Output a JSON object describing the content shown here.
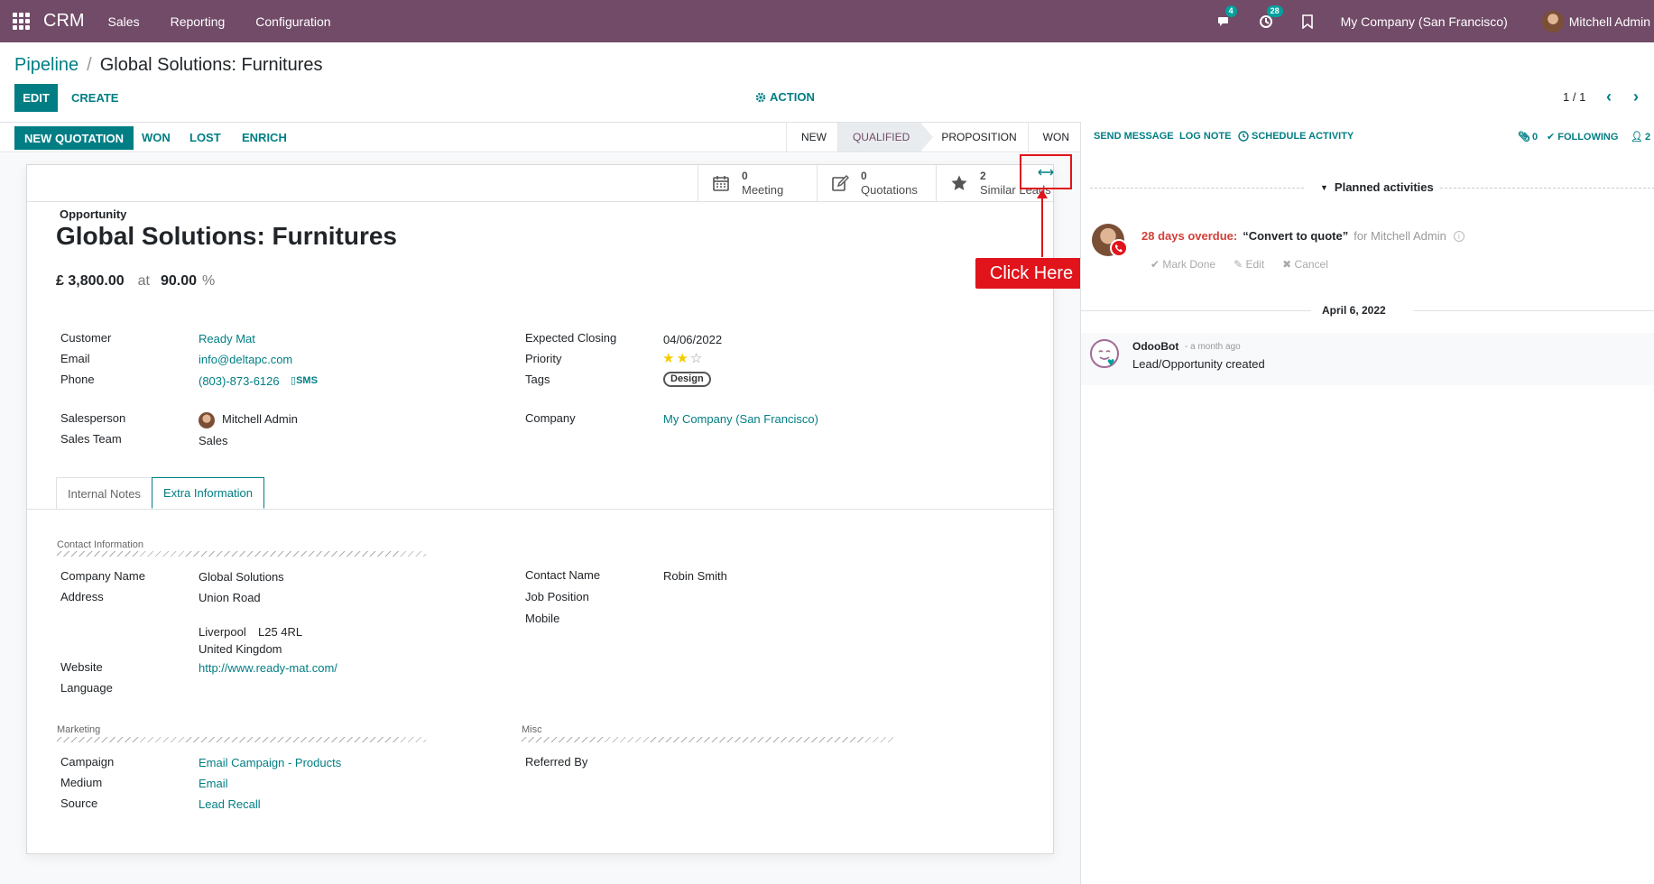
{
  "navbar": {
    "app_name": "CRM",
    "menu": [
      "Sales",
      "Reporting",
      "Configuration"
    ],
    "messages_count": "4",
    "activities_count": "28",
    "company": "My Company (San Francisco)",
    "user": "Mitchell Admin",
    "color": "#714b67"
  },
  "breadcrumb": {
    "parent": "Pipeline",
    "separator": "/",
    "current": "Global Solutions: Furnitures"
  },
  "controls": {
    "edit": "EDIT",
    "create": "CREATE",
    "action": "ACTION",
    "pager": "1 / 1"
  },
  "statusbar": {
    "new_quotation": "NEW QUOTATION",
    "won": "WON",
    "lost": "LOST",
    "enrich": "ENRICH",
    "stages": [
      "NEW",
      "QUALIFIED",
      "PROPOSITION",
      "WON"
    ],
    "active_stage": "QUALIFIED"
  },
  "smart_buttons": [
    {
      "count": "0",
      "label": "Meeting",
      "icon": "calendar-icon"
    },
    {
      "count": "0",
      "label": "Quotations",
      "icon": "edit-icon"
    },
    {
      "count": "2",
      "label": "Similar Leads",
      "icon": "star-icon"
    }
  ],
  "annotation": {
    "callout": "Click Here",
    "color": "#e1141b"
  },
  "form": {
    "type_label": "Opportunity",
    "title": "Global Solutions: Furnitures",
    "revenue": "£ 3,800.00",
    "at": "at",
    "probability": "90.00",
    "percent": "%",
    "fields_left": {
      "customer_label": "Customer",
      "customer": "Ready Mat",
      "email_label": "Email",
      "email": "info@deltapc.com",
      "phone_label": "Phone",
      "phone": "(803)-873-6126",
      "sms": "SMS",
      "salesperson_label": "Salesperson",
      "salesperson": "Mitchell Admin",
      "team_label": "Sales Team",
      "team": "Sales"
    },
    "fields_right": {
      "closing_label": "Expected Closing",
      "closing": "04/06/2022",
      "priority_label": "Priority",
      "priority_stars": 2,
      "priority_max": 3,
      "tags_label": "Tags",
      "tag": "Design",
      "company_label": "Company",
      "company": "My Company (San Francisco)"
    },
    "tabs": [
      "Internal Notes",
      "Extra Information"
    ],
    "active_tab": "Extra Information",
    "contact_section": "Contact Information",
    "company_name_label": "Company Name",
    "company_name": "Global Solutions",
    "address_label": "Address",
    "street": "Union Road",
    "city": "Liverpool",
    "zip": "L25 4RL",
    "country": "United Kingdom",
    "website_label": "Website",
    "website": "http://www.ready-mat.com/",
    "language_label": "Language",
    "contact_name_label": "Contact Name",
    "contact_name": "Robin Smith",
    "job_label": "Job Position",
    "mobile_label": "Mobile",
    "marketing_section": "Marketing",
    "campaign_label": "Campaign",
    "campaign": "Email Campaign - Products",
    "medium_label": "Medium",
    "medium": "Email",
    "source_label": "Source",
    "source": "Lead Recall",
    "misc_section": "Misc",
    "referred_label": "Referred By"
  },
  "chatter": {
    "send_message": "SEND MESSAGE",
    "log_note": "LOG NOTE",
    "schedule_activity": "SCHEDULE ACTIVITY",
    "attachments": "0",
    "following": "FOLLOWING",
    "followers": "2",
    "planned_title": "Planned activities",
    "overdue": "28 days overdue:",
    "activity_summary": "“Convert to quote”",
    "activity_for": "for Mitchell Admin",
    "mark_done": "Mark Done",
    "edit": "Edit",
    "cancel": "Cancel",
    "date": "April 6, 2022",
    "author": "OdooBot",
    "time": "- a month ago",
    "body": "Lead/Opportunity created"
  }
}
